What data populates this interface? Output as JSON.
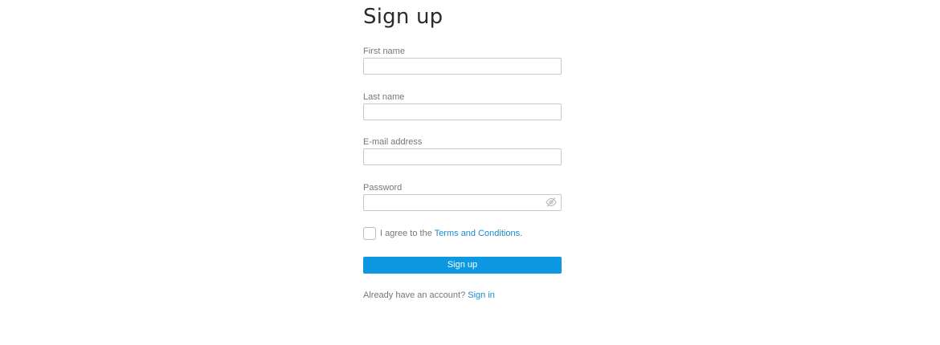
{
  "form": {
    "title": "Sign up",
    "fields": [
      {
        "label": "First name",
        "value": "",
        "placeholder": ""
      },
      {
        "label": "Last name",
        "value": "",
        "placeholder": ""
      },
      {
        "label": "E-mail address",
        "value": "",
        "placeholder": ""
      },
      {
        "label": "Password",
        "value": "",
        "placeholder": ""
      }
    ],
    "password_toggle_icon": "eye-slash-icon",
    "terms": {
      "checked": false,
      "prefix": "I agree to the ",
      "link_text": "Terms and Conditions",
      "suffix": "."
    },
    "submit_label": "Sign up",
    "signin": {
      "prompt": "Already have an account? ",
      "link_text": "Sign in"
    },
    "colors": {
      "accent": "#0d98e2",
      "link": "#1a8bd0"
    }
  }
}
